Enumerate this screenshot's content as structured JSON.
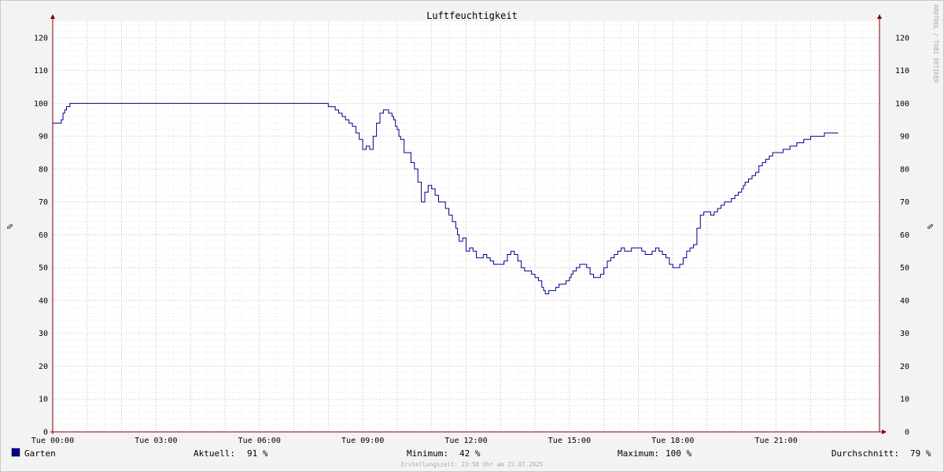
{
  "chart_data": {
    "type": "line",
    "title": "Luftfeuchtigkeit",
    "ylabel": "%",
    "ylim": [
      0,
      125
    ],
    "y_ticks": [
      0,
      10,
      20,
      30,
      40,
      50,
      60,
      70,
      80,
      90,
      100,
      110,
      120
    ],
    "x_ticks": [
      {
        "hour": 0,
        "label": "Tue 00:00"
      },
      {
        "hour": 3,
        "label": "Tue 03:00"
      },
      {
        "hour": 6,
        "label": "Tue 06:00"
      },
      {
        "hour": 9,
        "label": "Tue 09:00"
      },
      {
        "hour": 12,
        "label": "Tue 12:00"
      },
      {
        "hour": 15,
        "label": "Tue 15:00"
      },
      {
        "hour": 18,
        "label": "Tue 18:00"
      },
      {
        "hour": 21,
        "label": "Tue 21:00"
      }
    ],
    "xlim_hours": [
      0,
      24
    ],
    "grid": true,
    "series": [
      {
        "name": "Garten",
        "color": "#000090",
        "x_hours": [
          0,
          0.15,
          0.25,
          0.3,
          0.35,
          0.4,
          0.45,
          0.5,
          0.6,
          7.9,
          8.0,
          8.2,
          8.3,
          8.4,
          8.5,
          8.6,
          8.7,
          8.8,
          8.9,
          9.0,
          9.1,
          9.2,
          9.3,
          9.4,
          9.5,
          9.6,
          9.7,
          9.75,
          9.8,
          9.85,
          9.9,
          9.95,
          10.0,
          10.05,
          10.1,
          10.2,
          10.4,
          10.5,
          10.6,
          10.7,
          10.8,
          10.9,
          11.0,
          11.1,
          11.2,
          11.3,
          11.4,
          11.5,
          11.6,
          11.7,
          11.75,
          11.8,
          11.9,
          12.0,
          12.1,
          12.2,
          12.3,
          12.4,
          12.5,
          12.6,
          12.7,
          12.8,
          12.9,
          13.0,
          13.1,
          13.2,
          13.3,
          13.4,
          13.5,
          13.6,
          13.7,
          13.8,
          13.9,
          14.0,
          14.1,
          14.2,
          14.25,
          14.3,
          14.4,
          14.5,
          14.6,
          14.7,
          14.8,
          14.9,
          15.0,
          15.05,
          15.1,
          15.2,
          15.3,
          15.4,
          15.5,
          15.6,
          15.7,
          15.8,
          15.9,
          16.0,
          16.1,
          16.2,
          16.3,
          16.4,
          16.5,
          16.6,
          16.7,
          16.8,
          16.9,
          17.0,
          17.1,
          17.2,
          17.3,
          17.4,
          17.5,
          17.6,
          17.7,
          17.8,
          17.9,
          18.0,
          18.1,
          18.2,
          18.3,
          18.4,
          18.5,
          18.6,
          18.7,
          18.8,
          18.9,
          19.0,
          19.1,
          19.2,
          19.3,
          19.4,
          19.5,
          19.6,
          19.7,
          19.8,
          19.9,
          20.0,
          20.05,
          20.1,
          20.2,
          20.3,
          20.4,
          20.5,
          20.6,
          20.7,
          20.8,
          20.9,
          21.0,
          21.2,
          21.4,
          21.6,
          21.8,
          22.0,
          22.2,
          22.4,
          22.6,
          22.8,
          23.0,
          23.2,
          23.4,
          23.6,
          23.8,
          23.9,
          24.0
        ],
        "values": [
          94,
          94,
          95,
          97,
          98,
          99,
          99,
          100,
          100,
          100,
          99,
          98,
          97,
          96,
          95,
          94,
          93,
          91,
          89,
          86,
          87,
          86,
          90,
          94,
          97,
          98,
          98,
          97,
          97,
          96,
          95,
          93,
          92,
          90,
          89,
          85,
          82,
          80,
          76,
          70,
          73,
          75,
          74,
          72,
          70,
          70,
          68,
          66,
          64,
          62,
          60,
          58,
          59,
          55,
          56,
          55,
          53,
          53,
          54,
          53,
          52,
          51,
          51,
          51,
          52,
          54,
          55,
          54,
          52,
          50,
          49,
          49,
          48,
          47,
          46,
          44,
          43,
          42,
          43,
          43,
          44,
          45,
          45,
          46,
          47,
          48,
          49,
          50,
          51,
          51,
          50,
          48,
          47,
          47,
          48,
          50,
          52,
          53,
          54,
          55,
          56,
          55,
          55,
          56,
          56,
          56,
          55,
          54,
          54,
          55,
          56,
          55,
          54,
          53,
          51,
          50,
          50,
          51,
          53,
          55,
          56,
          57,
          62,
          66,
          67,
          67,
          66,
          67,
          68,
          69,
          70,
          70,
          71,
          72,
          73,
          74,
          75,
          76,
          77,
          78,
          79,
          81,
          82,
          83,
          84,
          85,
          85,
          86,
          87,
          88,
          89,
          90,
          90,
          91,
          91
        ]
      }
    ]
  },
  "legend": {
    "series_name": "Garten",
    "swatch_color": "#000090",
    "current_label": "Aktuell:",
    "current_value": "91 %",
    "min_label": "Minimum:",
    "min_value": "42 %",
    "max_label": "Maximum:",
    "max_value": "100 %",
    "avg_label": "Durchschnitt:",
    "avg_value": "79 %"
  },
  "footer": "Erstellungszeit: 23:58 Uhr am 22.07.2025",
  "watermark": "RRDTOOL / TOBI OETIKER",
  "colors": {
    "background": "#f3f3f3",
    "plot_background": "#ffffff",
    "major_grid": "#e8a0a0",
    "minor_grid": "#d8d8d8",
    "axis": "#800000",
    "line": "#000090"
  }
}
